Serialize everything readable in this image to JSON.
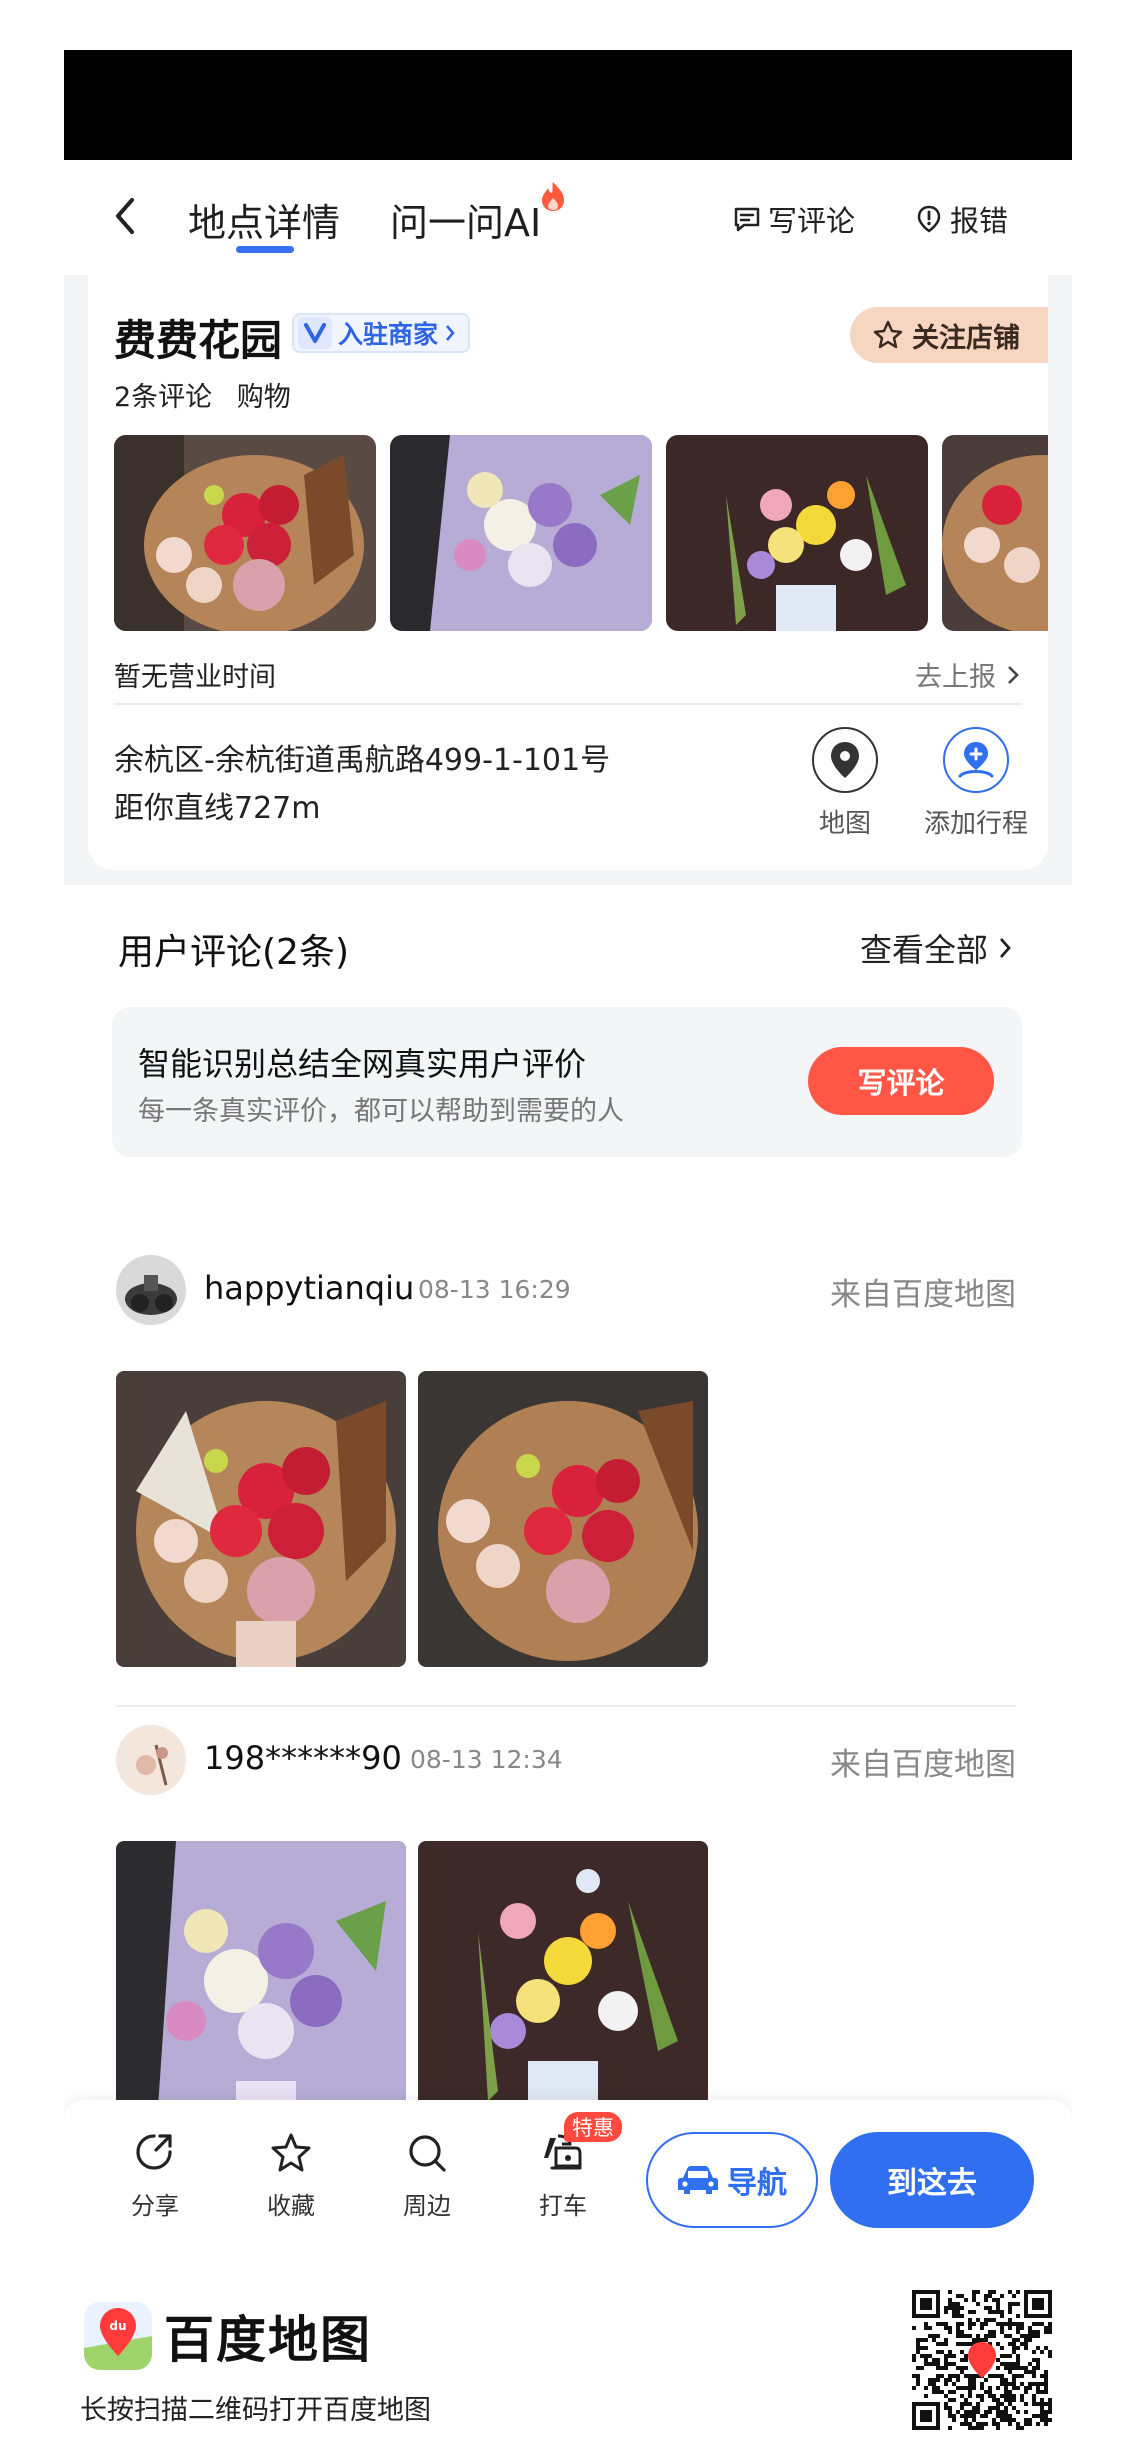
{
  "nav": {
    "tab_detail": "地点详情",
    "tab_ai": "问一问AI",
    "write_review": "写评论",
    "report_error": "报错"
  },
  "place": {
    "name": "费费花园",
    "merchant_badge": "入驻商家",
    "follow_label": "关注店铺",
    "review_count": "2条评论",
    "category": "购物",
    "hours_text": "暂无营业时间",
    "report_link": "去上报",
    "address": "余杭区-余杭街道禹航路499-1-101号",
    "distance": "距你直线727m",
    "map_label": "地图",
    "add_trip_label": "添加行程"
  },
  "reviews": {
    "title": "用户评论(2条)",
    "see_all": "查看全部",
    "ai_headline": "智能识别总结全网真实用户评价",
    "ai_sub": "每一条真实评价，都可以帮助到需要的人",
    "write_button": "写评论",
    "items": [
      {
        "user": "happytianqiu",
        "time": "08-13 16:29",
        "source": "来自百度地图"
      },
      {
        "user": "198******90",
        "time": "08-13 12:34",
        "source": "来自百度地图"
      }
    ]
  },
  "bottom_bar": {
    "share": "分享",
    "favorite": "收藏",
    "nearby": "周边",
    "taxi": "打车",
    "promo": "特惠",
    "navigate": "导航",
    "go_here": "到这去"
  },
  "footer": {
    "brand": "百度地图",
    "hint": "长按扫描二维码打开百度地图"
  },
  "colors": {
    "accent": "#2f6ff0",
    "write_button": "#ff5646",
    "follow_bg": "#f6d6c0"
  }
}
